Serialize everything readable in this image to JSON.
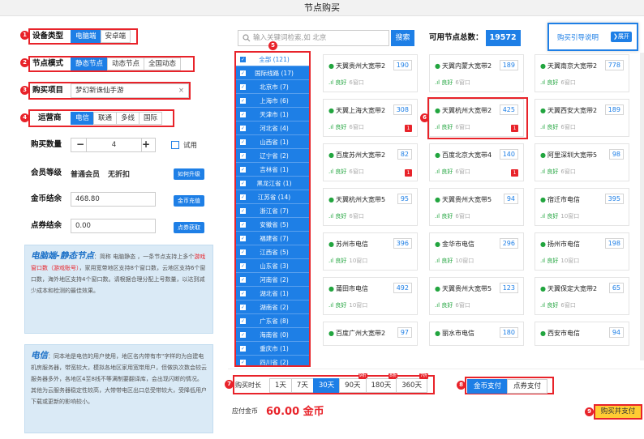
{
  "window": {
    "title": "节点购买"
  },
  "device": {
    "label": "设备类型",
    "options": [
      "电脑端",
      "安卓端"
    ],
    "selected": 0,
    "marker": "1"
  },
  "node_mode": {
    "label": "节点模式",
    "options": [
      "静态节点",
      "动态节点",
      "全国动态"
    ],
    "selected": 0,
    "marker": "2"
  },
  "project": {
    "label": "购买项目",
    "value": "梦幻新诛仙手游",
    "clear": "×",
    "marker": "3"
  },
  "carrier": {
    "label": "运营商",
    "options": [
      "电信",
      "联通",
      "多线",
      "国际"
    ],
    "selected": 0,
    "marker": "4"
  },
  "quantity": {
    "label": "购买数量",
    "minus": "−",
    "value": "4",
    "plus": "+",
    "trial": "试用"
  },
  "member": {
    "label": "会员等级",
    "level": "普通会员",
    "discount": "无折扣",
    "button": "如何升级"
  },
  "gold": {
    "label": "金币结余",
    "value": "468.80",
    "button": "金币充值"
  },
  "points": {
    "label": "点券结余",
    "value": "0.00",
    "button": "点券获取"
  },
  "info1": {
    "highlight": "电脑端-静态节点",
    "text_a": "：简称 电脑静态 ，一条节点支持上多个",
    "text_b": "游戏窗口数（游戏账号）",
    "text_c": "，家用宽带地区支持8个窗口数，云地区支持6个窗口数，海外地区支持4个窗口数。请根据合理分配上号数量，以达到减少成本和检测的最佳效果。"
  },
  "info2": {
    "highlight": "电信",
    "text": "：同本地是电信的用户使用，地区名内带有市\"字样的为自建电机房服务器，带宽较大，模拟各地区家用宽带用户，但做执次数会较云服务器多外，各地区4至8线不等满制要翻译库，会出现闪断的情况。其他为云服务器稳定性较高，大带带电区出口总受带较大，受降低用户下载或更新的影响较小。"
  },
  "search": {
    "placeholder": "输入关键词检索,如 北京",
    "button": "搜索"
  },
  "total": {
    "label": "可用节点总数：",
    "value": "19572"
  },
  "guide": {
    "label": "购买引导说明",
    "expand": "展开"
  },
  "regions": {
    "marker": "5",
    "items": [
      "全部 (121)",
      "国际线路 (17)",
      "北京市 (7)",
      "上海市 (6)",
      "天津市 (1)",
      "河北省 (4)",
      "山西省 (1)",
      "辽宁省 (2)",
      "吉林省 (1)",
      "黑龙江省 (1)",
      "江苏省 (14)",
      "浙江省 (7)",
      "安徽省 (5)",
      "福建省 (7)",
      "江西省 (5)",
      "山东省 (3)",
      "河南省 (2)",
      "湖北省 (1)",
      "湖南省 (2)",
      "广东省 (8)",
      "海南省 (0)",
      "重庆市 (1)",
      "四川省 (2)"
    ]
  },
  "cards_marker": "6",
  "cards": [
    {
      "name": "天翼贵州大宽带2",
      "count": "190",
      "status": "良好",
      "windows": "6窗口",
      "badge": ""
    },
    {
      "name": "天翼内蒙大宽带2",
      "count": "189",
      "status": "良好",
      "windows": "6窗口",
      "badge": ""
    },
    {
      "name": "天翼南京大宽带2",
      "count": "778",
      "status": "良好",
      "windows": "6窗口",
      "badge": ""
    },
    {
      "name": "天翼上海大宽带2",
      "count": "308",
      "status": "良好",
      "windows": "6窗口",
      "badge": "1"
    },
    {
      "name": "天翼杭州大宽带2",
      "count": "425",
      "status": "良好",
      "windows": "6窗口",
      "badge": "1"
    },
    {
      "name": "天翼西安大宽带2",
      "count": "189",
      "status": "良好",
      "windows": "6窗口",
      "badge": ""
    },
    {
      "name": "百度苏州大宽带2",
      "count": "82",
      "status": "良好",
      "windows": "6窗口",
      "badge": "1"
    },
    {
      "name": "百度北京大宽带4",
      "count": "140",
      "status": "良好",
      "windows": "6窗口",
      "badge": "1"
    },
    {
      "name": "阿里深圳大宽带5",
      "count": "98",
      "status": "良好",
      "windows": "6窗口",
      "badge": ""
    },
    {
      "name": "天翼杭州大宽带5",
      "count": "95",
      "status": "良好",
      "windows": "6窗口",
      "badge": ""
    },
    {
      "name": "天翼贵州大宽带5",
      "count": "94",
      "status": "良好",
      "windows": "6窗口",
      "badge": ""
    },
    {
      "name": "宿迁市电信",
      "count": "395",
      "status": "良好",
      "windows": "10窗口",
      "badge": ""
    },
    {
      "name": "苏州市电信",
      "count": "396",
      "status": "良好",
      "windows": "10窗口",
      "badge": ""
    },
    {
      "name": "金华市电信",
      "count": "296",
      "status": "良好",
      "windows": "10窗口",
      "badge": ""
    },
    {
      "name": "扬州市电信",
      "count": "198",
      "status": "良好",
      "windows": "10窗口",
      "badge": ""
    },
    {
      "name": "莆田市电信",
      "count": "492",
      "status": "良好",
      "windows": "10窗口",
      "badge": ""
    },
    {
      "name": "天翼贵州大宽带5",
      "count": "123",
      "status": "良好",
      "windows": "6窗口",
      "badge": ""
    },
    {
      "name": "天翼保定大宽带2",
      "count": "65",
      "status": "良好",
      "windows": "6窗口",
      "badge": ""
    },
    {
      "name": "百度广州大宽带2",
      "count": "97",
      "status": "",
      "windows": "",
      "badge": ""
    },
    {
      "name": "丽水市电信",
      "count": "180",
      "status": "",
      "windows": "",
      "badge": ""
    },
    {
      "name": "西安市电信",
      "count": "94",
      "status": "",
      "windows": "",
      "badge": ""
    }
  ],
  "duration": {
    "label": "购买时长",
    "marker": "7",
    "options": [
      {
        "label": "1天",
        "discount": ""
      },
      {
        "label": "7天",
        "discount": ""
      },
      {
        "label": "30天",
        "discount": ""
      },
      {
        "label": "90天",
        "discount": "9折"
      },
      {
        "label": "180天",
        "discount": "8折"
      },
      {
        "label": "360天",
        "discount": "7折"
      }
    ],
    "selected": 2
  },
  "payment": {
    "marker": "8",
    "options": [
      "金币支付",
      "点券支付"
    ],
    "selected": 0
  },
  "due": {
    "label": "应付金币",
    "value": "60.00 金币"
  },
  "buy": {
    "marker": "9",
    "label": "购买并支付"
  },
  "colors": {
    "accent": "#1e7fe6",
    "marker": "#e8232a",
    "online": "#22a53f",
    "buy": "#ffcc33"
  }
}
